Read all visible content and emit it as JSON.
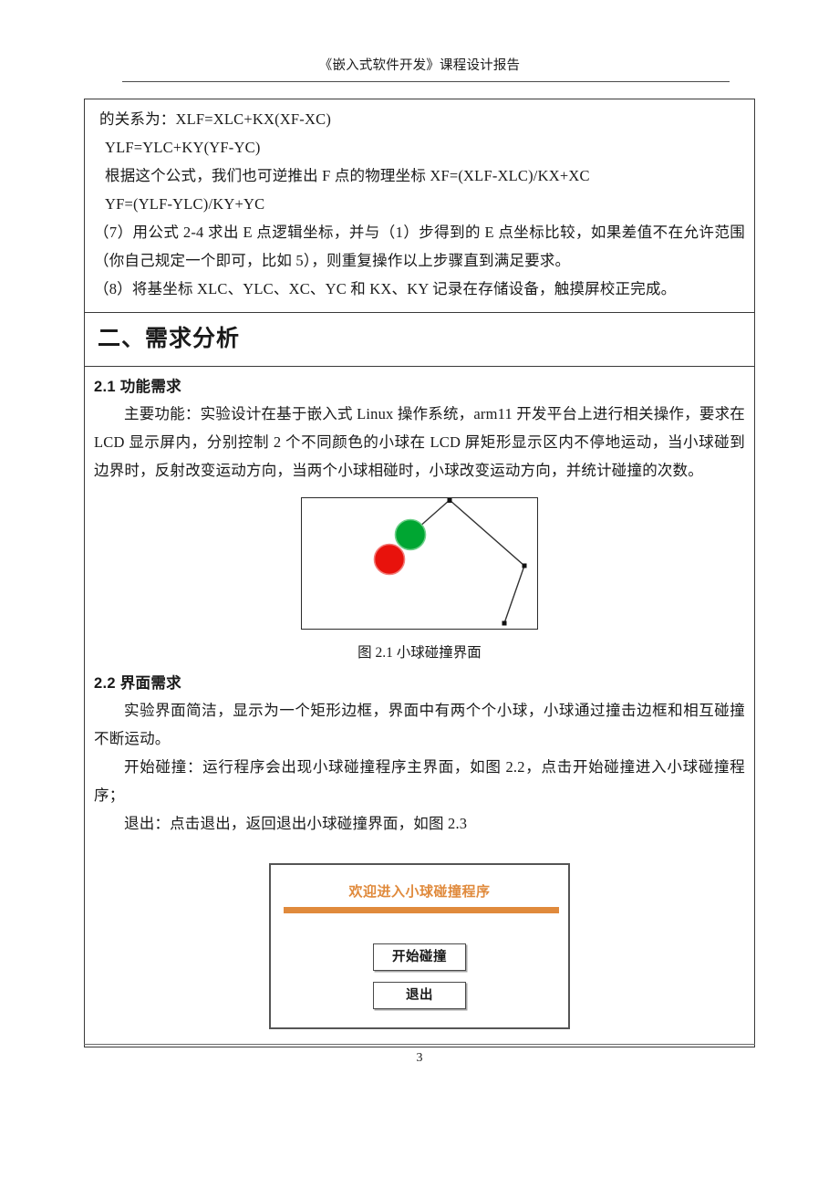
{
  "header": {
    "title": "《嵌入式软件开发》课程设计报告"
  },
  "cells": {
    "formula_block": {
      "lines": [
        "的关系为：XLF=XLC+KX(XF-XC)",
        "YLF=YLC+KY(YF-YC)",
        "根据这个公式，我们也可逆推出 F 点的物理坐标  XF=(XLF-XLC)/KX+XC",
        "YF=(YLF-YLC)/KY+YC"
      ],
      "step7": "（7）用公式 2-4 求出 E 点逻辑坐标，并与（1）步得到的 E 点坐标比较，如果差值不在允许范围（你自己规定一个即可，比如 5），则重复操作以上步骤直到满足要求。",
      "step8": "（8）将基坐标 XLC、YLC、XC、YC 和 KX、KY 记录在存储设备，触摸屏校正完成。"
    },
    "section_heading": "二、需求分析",
    "section_2_1": {
      "heading": "2.1 功能需求",
      "body": "主要功能：实验设计在基于嵌入式 Linux 操作系统，arm11 开发平台上进行相关操作，要求在 LCD 显示屏内，分别控制 2 个不同颜色的小球在 LCD 屏矩形显示区内不停地运动，当小球碰到边界时，反射改变运动方向，当两个小球相碰时，小球改变运动方向，并统计碰撞的次数。",
      "figure_caption": "图 2.1  小球碰撞界面"
    },
    "section_2_2": {
      "heading": "2.2 界面需求",
      "body1": "实验界面简洁，显示为一个矩形边框，界面中有两个个小球，小球通过撞击边框和相互碰撞不断运动。",
      "body2": "开始碰撞：运行程序会出现小球碰撞程序主界面，如图 2.2，点击开始碰撞进入小球碰撞程序；",
      "body3": "退出：点击退出，返回退出小球碰撞界面，如图 2.3"
    }
  },
  "figure_balls": {
    "green_ball_color": "#00a632",
    "red_ball_color": "#e8120c",
    "trajectory_color": "#333333",
    "border_color": "#2b2b2b"
  },
  "app_mock": {
    "welcome_text": "欢迎进入小球碰撞程序",
    "welcome_color": "#e08a3c",
    "divider_color": "#e08a3c",
    "start_button": "开始碰撞",
    "exit_button": "退出"
  },
  "footer": {
    "page_number": "3"
  }
}
